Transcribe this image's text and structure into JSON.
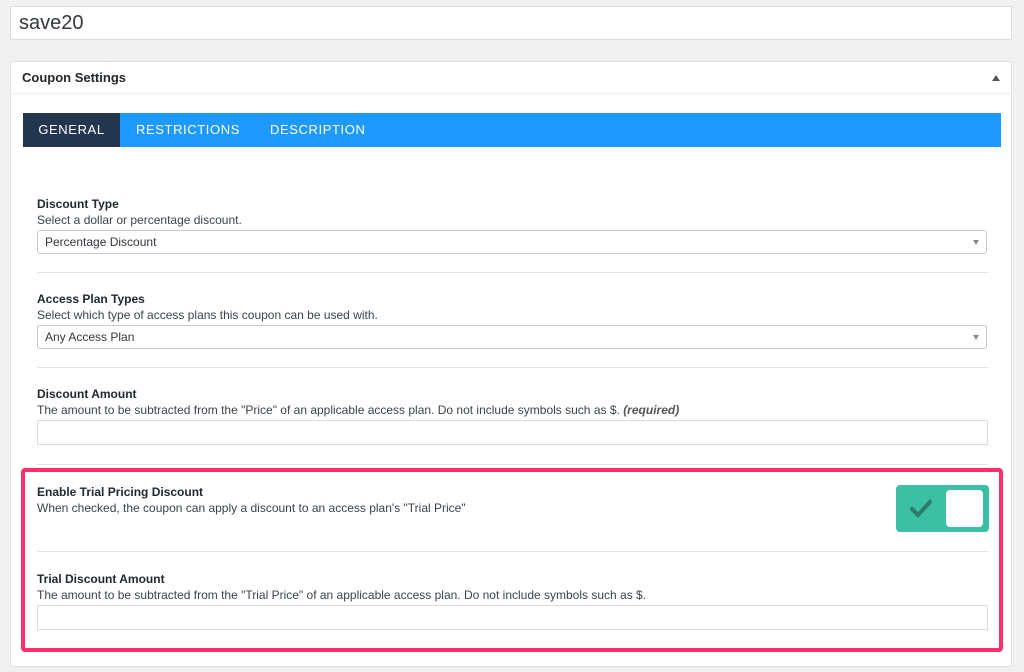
{
  "coupon": {
    "title": "save20"
  },
  "panel": {
    "title": "Coupon Settings"
  },
  "tabs": [
    {
      "label": "GENERAL"
    },
    {
      "label": "RESTRICTIONS"
    },
    {
      "label": "DESCRIPTION"
    }
  ],
  "fields": {
    "discount_type": {
      "label": "Discount Type",
      "description": "Select a dollar or percentage discount.",
      "value": "Percentage Discount"
    },
    "access_plan_types": {
      "label": "Access Plan Types",
      "description": "Select which type of access plans this coupon can be used with.",
      "value": "Any Access Plan"
    },
    "discount_amount": {
      "label": "Discount Amount",
      "description": "The amount to be subtracted from the \"Price\" of an applicable access plan. Do not include symbols such as $.",
      "required": "(required)",
      "value": ""
    },
    "enable_trial": {
      "label": "Enable Trial Pricing Discount",
      "description": "When checked, the coupon can apply a discount to an access plan's \"Trial Price\"",
      "checked": true
    },
    "trial_discount_amount": {
      "label": "Trial Discount Amount",
      "description": "The amount to be subtracted from the \"Trial Price\" of an applicable access plan. Do not include symbols such as $.",
      "value": ""
    }
  },
  "colors": {
    "tab_bar": "#1e9aff",
    "tab_active": "#22374f",
    "toggle_on": "#3cbfa3",
    "highlight": "#f5306d"
  }
}
